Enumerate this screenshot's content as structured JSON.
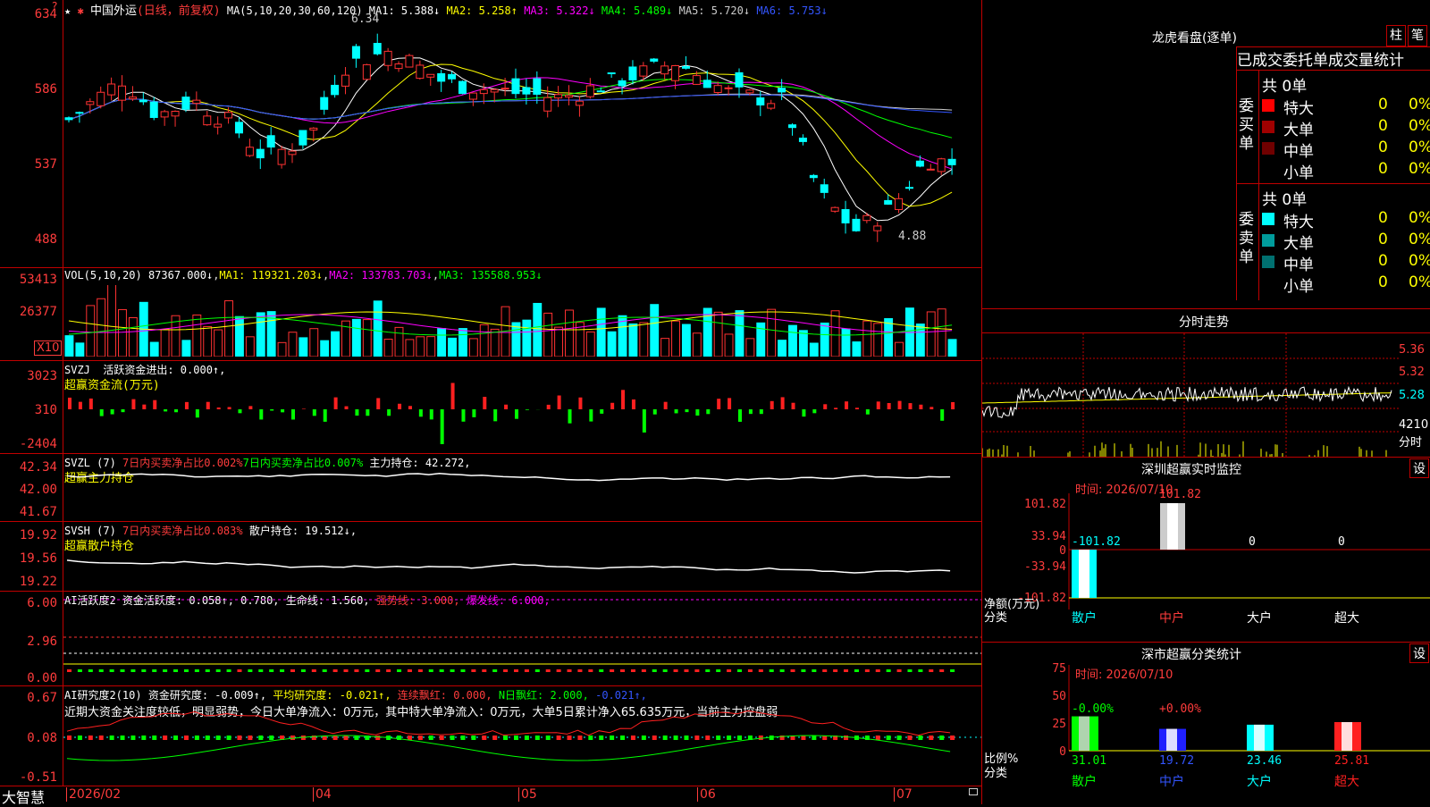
{
  "main": {
    "symbol": "中国外运",
    "mode": "(日线，前复权)",
    "ma_header": "MA(5,10,20,30,60,120)",
    "ma_values": [
      {
        "label": "MA1: 5.388↓",
        "color": "#ffffff"
      },
      {
        "label": "MA2: 5.258↑",
        "color": "#ffff00"
      },
      {
        "label": "MA3: 5.322↓",
        "color": "#ff00ff"
      },
      {
        "label": "MA4: 5.489↓",
        "color": "#00ff00"
      },
      {
        "label": "MA5: 5.720↓",
        "color": "#cccccc"
      },
      {
        "label": "MA6: 5.753↓",
        "color": "#3355ff"
      }
    ],
    "y_ticks": [
      "634",
      "586",
      "537",
      "488"
    ],
    "high_label": "6.34",
    "low_label": "4.88",
    "corner_mark": "?"
  },
  "vol": {
    "header": "VOL(5,10,20)",
    "val": "87367.000↓",
    "ma1": "MA1: 119321.203↓",
    "ma2": "MA2: 133783.703↓",
    "ma3": "MA3: 135588.953↓",
    "y_ticks": [
      "53413",
      "26377"
    ],
    "unit": "X10"
  },
  "svzj": {
    "header": "SVZJ",
    "text": "活跃资金进出: 0.000↑,",
    "subtitle": "超赢资金流(万元)",
    "y_ticks": [
      "3023",
      "310",
      "-2404"
    ]
  },
  "svzl": {
    "header": "SVZL (7)",
    "t1": "7日内买卖净占比0.002%",
    "t2": "7日内买卖净占比0.007%",
    "t3": "主力持仓: 42.272,",
    "subtitle": "超赢主力持仓",
    "y_ticks": [
      "42.34",
      "42.00",
      "41.67"
    ]
  },
  "svsh": {
    "header": "SVSH (7)",
    "t1": "7日内买卖净占比0.083%",
    "t2": "散户持仓: 19.512↓,",
    "subtitle": "超赢散户持仓",
    "y_ticks": [
      "19.92",
      "19.56",
      "19.22"
    ]
  },
  "ai1": {
    "header": "AI活跃度2",
    "t1": "资金活跃度: 0.058↑, 0.780,",
    "t2": "生命线: 1.560,",
    "t3": "强势线: 3.000,",
    "t4": "爆发线: 6.000,",
    "y_ticks": [
      "6.00",
      "2.96",
      "0.00"
    ]
  },
  "ai2": {
    "header": "AI研究度2(10)",
    "t1": "资金研究度: -0.009↑,",
    "t2": "平均研究度: -0.021↑,",
    "t3": "连续飘红: 0.000,",
    "t4": "N日飘红: 2.000,",
    "t5": "-0.021↑,",
    "summary": "近期大资金关注度较低，明显弱势，今日大单净流入：0万元，其中特大单净流入：0万元，大单5日累计净入65.635万元，当前主力控盘弱",
    "y_ticks": [
      "0.67",
      "0.08",
      "-0.51"
    ]
  },
  "xaxis": {
    "brand": "大智慧",
    "labels": [
      "2026/02",
      "04",
      "05",
      "06",
      "07"
    ]
  },
  "right": {
    "lhb_title": "龙虎看盘(逐单)",
    "btn_bar": "柱",
    "btn_pen": "笔",
    "tabs": [
      "已成交",
      "委托单",
      "成交量统计"
    ],
    "buy_side": {
      "label": "委买单",
      "total": "共 0单",
      "rows": [
        {
          "name": "特大",
          "count": "0",
          "pct": "0%",
          "color": "#ff0000"
        },
        {
          "name": "大单",
          "count": "0",
          "pct": "0%",
          "color": "#a00000"
        },
        {
          "name": "中单",
          "count": "0",
          "pct": "0%",
          "color": "#700000"
        },
        {
          "name": "小单",
          "count": "0",
          "pct": "0%",
          "color": "#000000"
        }
      ]
    },
    "sell_side": {
      "label": "委卖单",
      "total": "共 0单",
      "rows": [
        {
          "name": "特大",
          "count": "0",
          "pct": "0%",
          "color": "#00ffff"
        },
        {
          "name": "大单",
          "count": "0",
          "pct": "0%",
          "color": "#009c9c"
        },
        {
          "name": "中单",
          "count": "0",
          "pct": "0%",
          "color": "#007070"
        },
        {
          "name": "小单",
          "count": "0",
          "pct": "0%",
          "color": "#000000"
        }
      ]
    },
    "intraday_title": "分时走势",
    "intraday_ticks": [
      "5.36",
      "5.32",
      "5.28"
    ],
    "intraday_vol": "4210",
    "intraday_vol_label": "分时",
    "monitor": {
      "title": "深圳超赢实时监控",
      "set_btn": "设",
      "time": "时间: 2026/07/10",
      "y_ticks": [
        "101.82",
        "33.94",
        "0",
        "-33.94",
        "-101.82"
      ],
      "bar_labels": [
        "-101.82",
        "101.82",
        "0",
        "0"
      ],
      "axis_title": "净额(万元)",
      "axis_sub": "分类",
      "categories": [
        "散户",
        "中户",
        "大户",
        "超大"
      ]
    },
    "stats": {
      "title": "深市超赢分类统计",
      "set_btn": "设",
      "time": "时间: 2026/07/10",
      "y_ticks": [
        "75",
        "50",
        "25",
        "0"
      ],
      "top_labels": [
        "-0.00%",
        "+0.00%"
      ],
      "values": [
        "31.01",
        "19.72",
        "23.46",
        "25.81"
      ],
      "axis_title": "比例%",
      "axis_sub": "分类",
      "categories": [
        "散户",
        "中户",
        "大户",
        "超大"
      ]
    }
  }
}
